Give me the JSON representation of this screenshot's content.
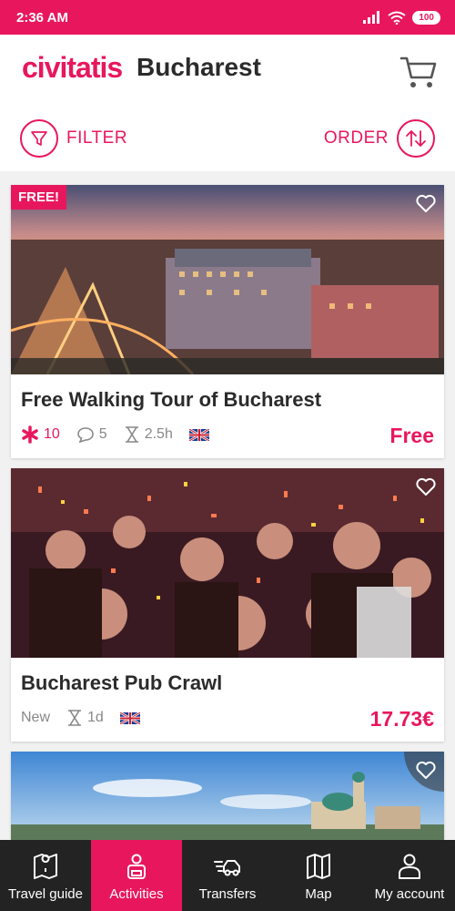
{
  "status": {
    "time": "2:36 AM",
    "battery": "100"
  },
  "header": {
    "logo": "civitatis",
    "city": "Bucharest"
  },
  "toolbar": {
    "filter_label": "FILTER",
    "order_label": "ORDER"
  },
  "cards": [
    {
      "title": "Free Walking Tour of Bucharest",
      "badge": "FREE!",
      "rating": "10",
      "comments": "5",
      "duration": "2.5h",
      "price": "Free"
    },
    {
      "title": "Bucharest Pub Crawl",
      "status": "New",
      "duration": "1d",
      "price": "17.73€"
    }
  ],
  "nav": {
    "items": [
      {
        "label": "Travel guide",
        "icon": "map-book-icon"
      },
      {
        "label": "Activities",
        "icon": "person-icon"
      },
      {
        "label": "Transfers",
        "icon": "car-icon"
      },
      {
        "label": "Map",
        "icon": "map-icon"
      },
      {
        "label": "My account",
        "icon": "user-icon"
      }
    ],
    "active": "Activities"
  },
  "colors": {
    "accent": "#e8175d",
    "nav_bg": "#232323",
    "text": "#2b2b2b"
  }
}
